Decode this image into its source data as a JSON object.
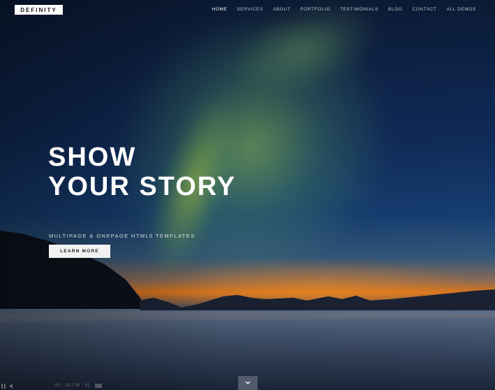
{
  "brand": {
    "logo_text": "DEFINITY"
  },
  "nav": {
    "items": [
      {
        "label": "HOME",
        "active": true
      },
      {
        "label": "SERVICES"
      },
      {
        "label": "ABOUT"
      },
      {
        "label": "PORTFOLIO"
      },
      {
        "label": "TESTIMONIALS"
      },
      {
        "label": "BLOG"
      },
      {
        "label": "CONTACT"
      },
      {
        "label": "ALL DEMOS"
      }
    ]
  },
  "hero": {
    "title_line1": "SHOW",
    "title_line2": "YOUR STORY",
    "subtitle": "MULTIPAGE & ONEPAGE HTML5 TEMPLATES",
    "cta_label": "LEARN MORE"
  },
  "video": {
    "time": "03 : 20 / 05 : 32"
  },
  "icons": {
    "scroll": "chevron-down-icon",
    "pause": "pause-icon",
    "volume": "volume-icon"
  }
}
